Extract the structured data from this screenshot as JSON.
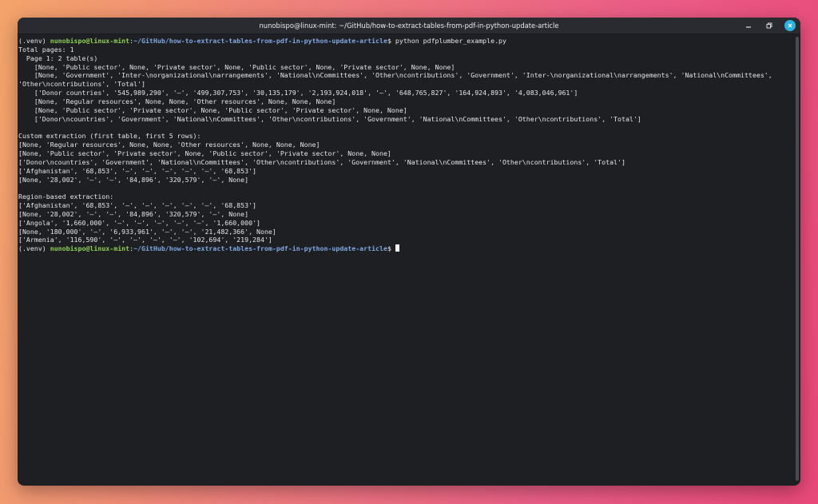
{
  "window": {
    "title": "nunobispo@linux-mint: ~/GitHub/how-to-extract-tables-from-pdf-in-python-update-article",
    "controls": [
      "minimize-icon",
      "maximize-icon",
      "close-icon"
    ],
    "colors": {
      "close_button": "#2bb3e5",
      "user": "#8fd14f",
      "path": "#7fa7e0",
      "background": "#1e1f23"
    }
  },
  "terminal": {
    "prompt1": {
      "venv": "(.venv) ",
      "user_host": "nunobispo@linux-mint",
      "colon": ":",
      "path": "~/GitHub/how-to-extract-tables-from-pdf-in-python-update-article",
      "symbol": "$ ",
      "command": "python pdfplumber_example.py"
    },
    "output1": [
      "Total pages: 1",
      "  Page 1: 2 table(s)",
      "    [None, 'Public sector', None, 'Private sector', None, 'Public sector', None, 'Private sector', None, None]",
      "    [None, 'Government', 'Inter-\\norganizational\\narrangements', 'National\\nCommittees', 'Other\\ncontributions', 'Government', 'Inter-\\norganizational\\narrangements', 'National\\nCommittees',",
      "'Other\\ncontributions', 'Total']",
      "    ['Donor countries', '545,989,290', '–', '499,307,753', '30,135,179', '2,193,924,018', '–', '648,765,827', '164,924,893', '4,083,046,961']",
      "    [None, 'Regular resources', None, None, 'Other resources', None, None, None]",
      "    [None, 'Public sector', 'Private sector', None, 'Public sector', 'Private sector', None, None]",
      "    ['Donor\\ncountries', 'Government', 'National\\nCommittees', 'Other\\ncontributions', 'Government', 'National\\nCommittees', 'Other\\ncontributions', 'Total']",
      "",
      "Custom extraction (first table, first 5 rows):",
      "[None, 'Regular resources', None, None, 'Other resources', None, None, None]",
      "[None, 'Public sector', 'Private sector', None, 'Public sector', 'Private sector', None, None]",
      "['Donor\\ncountries', 'Government', 'National\\nCommittees', 'Other\\ncontributions', 'Government', 'National\\nCommittees', 'Other\\ncontributions', 'Total']",
      "['Afghanistan', '68,853', '–', '–', '–', '–', '–', '68,853']",
      "[None, '28,002', '–', '–', '84,896', '320,579', '–', None]",
      "",
      "Region-based extraction:",
      "['Afghanistan', '68,853', '–', '–', '–', '–', '–', '68,853']",
      "[None, '28,002', '–', '–', '84,896', '320,579', '–', None]",
      "['Angola', '1,660,000', '–', '–', '–', '–', '–', '1,660,000']",
      "[None, '180,000', '–', '6,933,961', '–', '–', '21,482,366', None]",
      "['Armenia', '116,590', '–', '–', '–', '–', '102,694', '219,284']"
    ],
    "prompt2": {
      "venv": "(.venv) ",
      "user_host": "nunobispo@linux-mint",
      "colon": ":",
      "path": "~/GitHub/how-to-extract-tables-from-pdf-in-python-update-article",
      "symbol": "$ "
    }
  }
}
